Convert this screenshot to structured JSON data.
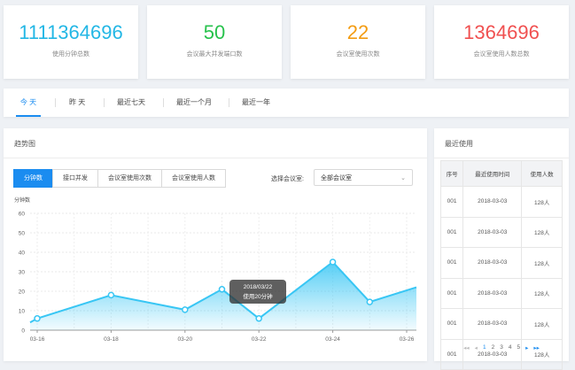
{
  "stats": [
    {
      "value": "1111364696",
      "label": "使用分钟总数",
      "color": "#23b7e5"
    },
    {
      "value": "50",
      "label": "会议最大并发端口数",
      "color": "#27c24c"
    },
    {
      "value": "22",
      "label": "会议室使用次数",
      "color": "#f39c12"
    },
    {
      "value": "1364696",
      "label": "会议室使用人数总数",
      "color": "#f05050"
    }
  ],
  "range_tabs": [
    {
      "label": "今 天",
      "active": true
    },
    {
      "label": "昨 天",
      "active": false
    },
    {
      "label": "最近七天",
      "active": false
    },
    {
      "label": "最近一个月",
      "active": false
    },
    {
      "label": "最近一年",
      "active": false
    }
  ],
  "trend": {
    "title": "趋势图",
    "metric_tabs": [
      {
        "label": "分钟数",
        "active": true
      },
      {
        "label": "接口并发",
        "active": false
      },
      {
        "label": "会议室使用次数",
        "active": false
      },
      {
        "label": "会议室使用人数",
        "active": false
      }
    ],
    "room_label": "选择会议室:",
    "room_select_value": "全部会议室"
  },
  "tooltip": {
    "date": "2018/03/22",
    "text": "使用20分钟"
  },
  "recent": {
    "title": "最近使用",
    "headers": [
      "序号",
      "最近使用时间",
      "使用人数"
    ],
    "rows": [
      [
        "001",
        "2018-03-03",
        "128人"
      ],
      [
        "001",
        "2018-03-03",
        "128人"
      ],
      [
        "001",
        "2018-03-03",
        "128人"
      ],
      [
        "001",
        "2018-03-03",
        "128人"
      ],
      [
        "001",
        "2018-03-03",
        "128人"
      ],
      [
        "001",
        "2018-03-03",
        "128人"
      ]
    ],
    "pager": {
      "first": "◂◂",
      "prev": "◂",
      "pages": [
        "1",
        "2",
        "3",
        "4",
        "5"
      ],
      "active_page": "1",
      "next": "▸",
      "last": "▸▸"
    }
  },
  "chart_data": {
    "type": "area",
    "ylabel": "分钟数",
    "ylim": [
      0,
      60
    ],
    "yticks": [
      0,
      10,
      20,
      30,
      40,
      50,
      60
    ],
    "xtick_labels": [
      "03-16",
      "03-18",
      "03-20",
      "03-22",
      "03-24",
      "03-26"
    ],
    "grid": true,
    "series": [
      {
        "x": [
          "03-15",
          "03-16",
          "03-18",
          "03-20",
          "03-21",
          "03-22",
          "03-24",
          "03-25",
          "03-26"
        ],
        "values": [
          4,
          6,
          18,
          10.5,
          21,
          6,
          35,
          14.5,
          22
        ],
        "color": "#38c6f4"
      }
    ]
  }
}
